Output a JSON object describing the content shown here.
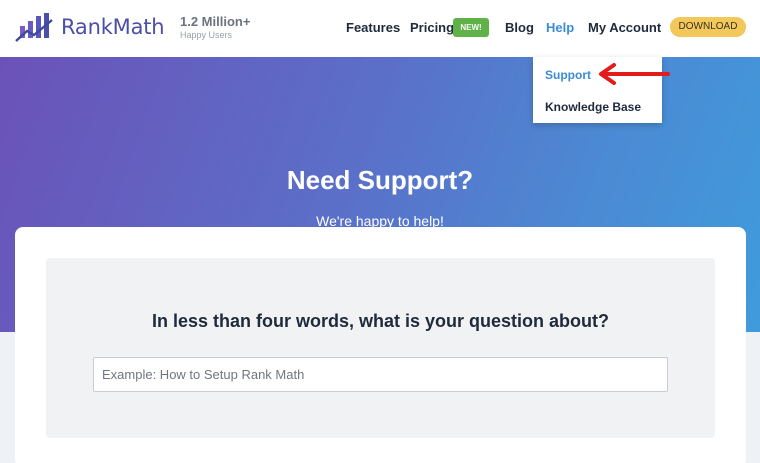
{
  "brand": {
    "name_part1": "Rank",
    "name_part2": "Math",
    "stat_value": "1.2 Million+",
    "stat_label": "Happy Users",
    "color": "#4b4fa5"
  },
  "nav": {
    "features": "Features",
    "pricing": "Pricing",
    "pricing_badge": "NEW!",
    "blog": "Blog",
    "help": "Help",
    "account": "My Account",
    "download": "DOWNLOAD"
  },
  "help_menu": {
    "items": [
      "Support",
      "Knowledge Base"
    ],
    "annotation": "red-arrow-icon"
  },
  "hero": {
    "title": "Need Support?",
    "subtitle": "We're happy to help!"
  },
  "support_form": {
    "question": "In less than four words, what is your question about?",
    "placeholder": "Example: How to Setup Rank Math",
    "value": ""
  },
  "colors": {
    "accent": "#3b8cd6",
    "badge": "#5fb247",
    "download": "#f1c859",
    "arrow": "#e21b1b"
  }
}
